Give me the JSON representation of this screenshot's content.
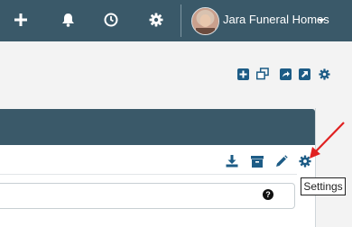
{
  "navbar": {
    "icons": [
      "plus-icon",
      "bell-icon",
      "clock-icon",
      "gear-icon"
    ],
    "user_name": "Jara Funeral Homes",
    "background": "#3a5969"
  },
  "toolbar": {
    "icons": [
      "add-box-icon",
      "clone-icon",
      "share-icon",
      "external-link-icon",
      "gear-icon"
    ],
    "color": "#1d5c86"
  },
  "panel_tools": {
    "icons": [
      "download-icon",
      "archive-icon",
      "pencil-icon",
      "gear-icon"
    ]
  },
  "field": {
    "help_icon": "question-icon",
    "help_glyph": "?"
  },
  "tooltip": {
    "text": "Settings"
  },
  "annotation": {
    "color": "#e02020"
  }
}
